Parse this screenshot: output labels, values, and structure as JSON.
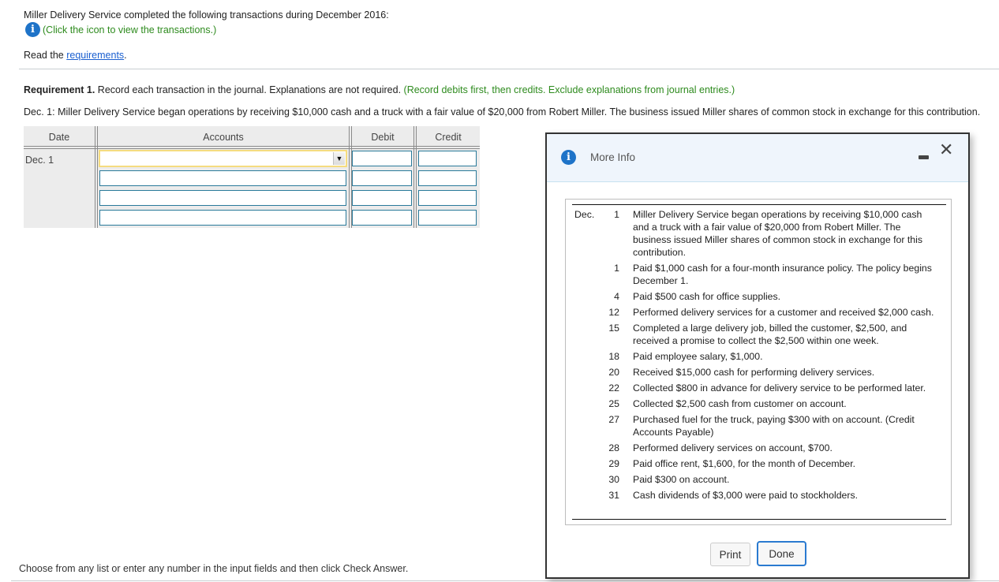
{
  "intro": {
    "heading": "Miller Delivery Service completed the following transactions during December 2016:",
    "info_hint": "(Click the icon to view the transactions.)",
    "read_prefix": "Read the ",
    "requirements_link": "requirements",
    "read_suffix": "."
  },
  "requirement": {
    "label": "Requirement 1.",
    "text": " Record each transaction in the journal. Explanations are not required. ",
    "hint": "(Record debits first, then credits. Exclude explanations from journal entries.)",
    "transaction_desc": "Dec. 1: Miller Delivery Service began operations by receiving $10,000 cash and a truck with a fair value of $20,000 from Robert Miller. The business issued Miller shares of common stock in exchange for this contribution."
  },
  "journal": {
    "headers": {
      "date": "Date",
      "accounts": "Accounts",
      "debit": "Debit",
      "credit": "Credit"
    },
    "date": "Dec. 1",
    "rows": [
      {
        "account": "",
        "debit": "",
        "credit": ""
      },
      {
        "account": "",
        "debit": "",
        "credit": ""
      },
      {
        "account": "",
        "debit": "",
        "credit": ""
      },
      {
        "account": "",
        "debit": "",
        "credit": ""
      }
    ],
    "dropdown_icon": "▼"
  },
  "footer_hint": "Choose from any list or enter any number in the input fields and then click Check Answer.",
  "modal": {
    "title": "More Info",
    "info_icon": "i",
    "close_icon": "✕",
    "month": "Dec.",
    "transactions": [
      {
        "day": "1",
        "desc": "Miller Delivery Service began operations by receiving $10,000 cash and a truck with a fair value of $20,000 from Robert Miller. The business issued Miller shares of common stock in exchange for this contribution."
      },
      {
        "day": "1",
        "desc": "Paid $1,000 cash for a four-month insurance policy. The policy begins December 1."
      },
      {
        "day": "4",
        "desc": "Paid $500 cash for office supplies."
      },
      {
        "day": "12",
        "desc": "Performed delivery services for a customer and received $2,000 cash."
      },
      {
        "day": "15",
        "desc": "Completed a large delivery job, billed the customer, $2,500, and received a promise to collect the $2,500 within one week."
      },
      {
        "day": "18",
        "desc": "Paid employee salary, $1,000."
      },
      {
        "day": "20",
        "desc": "Received $15,000 cash for performing delivery services."
      },
      {
        "day": "22",
        "desc": "Collected $800 in advance for delivery service to be performed later."
      },
      {
        "day": "25",
        "desc": "Collected $2,500 cash from customer on account."
      },
      {
        "day": "27",
        "desc": "Purchased fuel for the truck, paying $300 with on account. (Credit Accounts Payable)"
      },
      {
        "day": "28",
        "desc": "Performed delivery services on account, $700."
      },
      {
        "day": "29",
        "desc": "Paid office rent, $1,600, for the month of December."
      },
      {
        "day": "30",
        "desc": "Paid $300 on account."
      },
      {
        "day": "31",
        "desc": "Cash dividends of $3,000 were paid to stockholders."
      }
    ],
    "print_label": "Print",
    "done_label": "Done"
  },
  "colors": {
    "accent_blue": "#1e73c8",
    "hint_green": "#2e8b1e",
    "link_blue": "#1a5fd0",
    "input_border": "#2a7a9a",
    "focus_yellow": "#f5dc80"
  }
}
